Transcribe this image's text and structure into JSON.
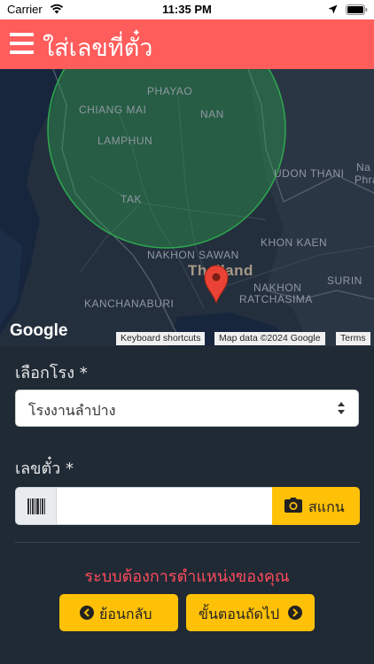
{
  "status_bar": {
    "carrier": "Carrier",
    "time": "11:35 PM"
  },
  "header": {
    "title": "ใส่เลขที่ตั๋ว",
    "menu_icon": "hamburger-menu-icon"
  },
  "map": {
    "labels": {
      "phayao": "PHAYAO",
      "chiang_mai": "CHIANG MAI",
      "nan": "NAN",
      "lamphun": "LAMPHUN",
      "udon_thani": "UDON THANI",
      "nakhon_phanom_partial": "Na",
      "phra_partial": "Phra",
      "tak": "TAK",
      "khon_kaen": "KHON KAEN",
      "nakhon_sawan": "NAKHON SAWAN",
      "thailand": "Thailand",
      "surin": "SURIN",
      "nakhon_ratchasima_1": "NAKHON",
      "nakhon_ratchasima_2": "RATCHASIMA",
      "kanchanaburi": "KANCHANABURI"
    },
    "google_logo": "Google",
    "keyboard_shortcuts": "Keyboard shortcuts",
    "map_data": "Map data ©2024 Google",
    "terms": "Terms",
    "circle_color": "#2ea84f",
    "pin_color": "#ea4335"
  },
  "form": {
    "factory_label": "เลือกโรง *",
    "factory_selected": "โรงงานลำปาง",
    "ticket_label": "เลขตั๋ว *",
    "ticket_value": "",
    "scan_label": "สแกน",
    "warning": "ระบบต้องการตำแหน่งของคุณ",
    "back_label": "ย้อนกลับ",
    "next_label": "ขั้นตอนถัดไป"
  },
  "colors": {
    "header": "#ff5c5c",
    "accent": "#ffc107",
    "warning": "#ff4b5c",
    "background": "#1f2a35"
  }
}
